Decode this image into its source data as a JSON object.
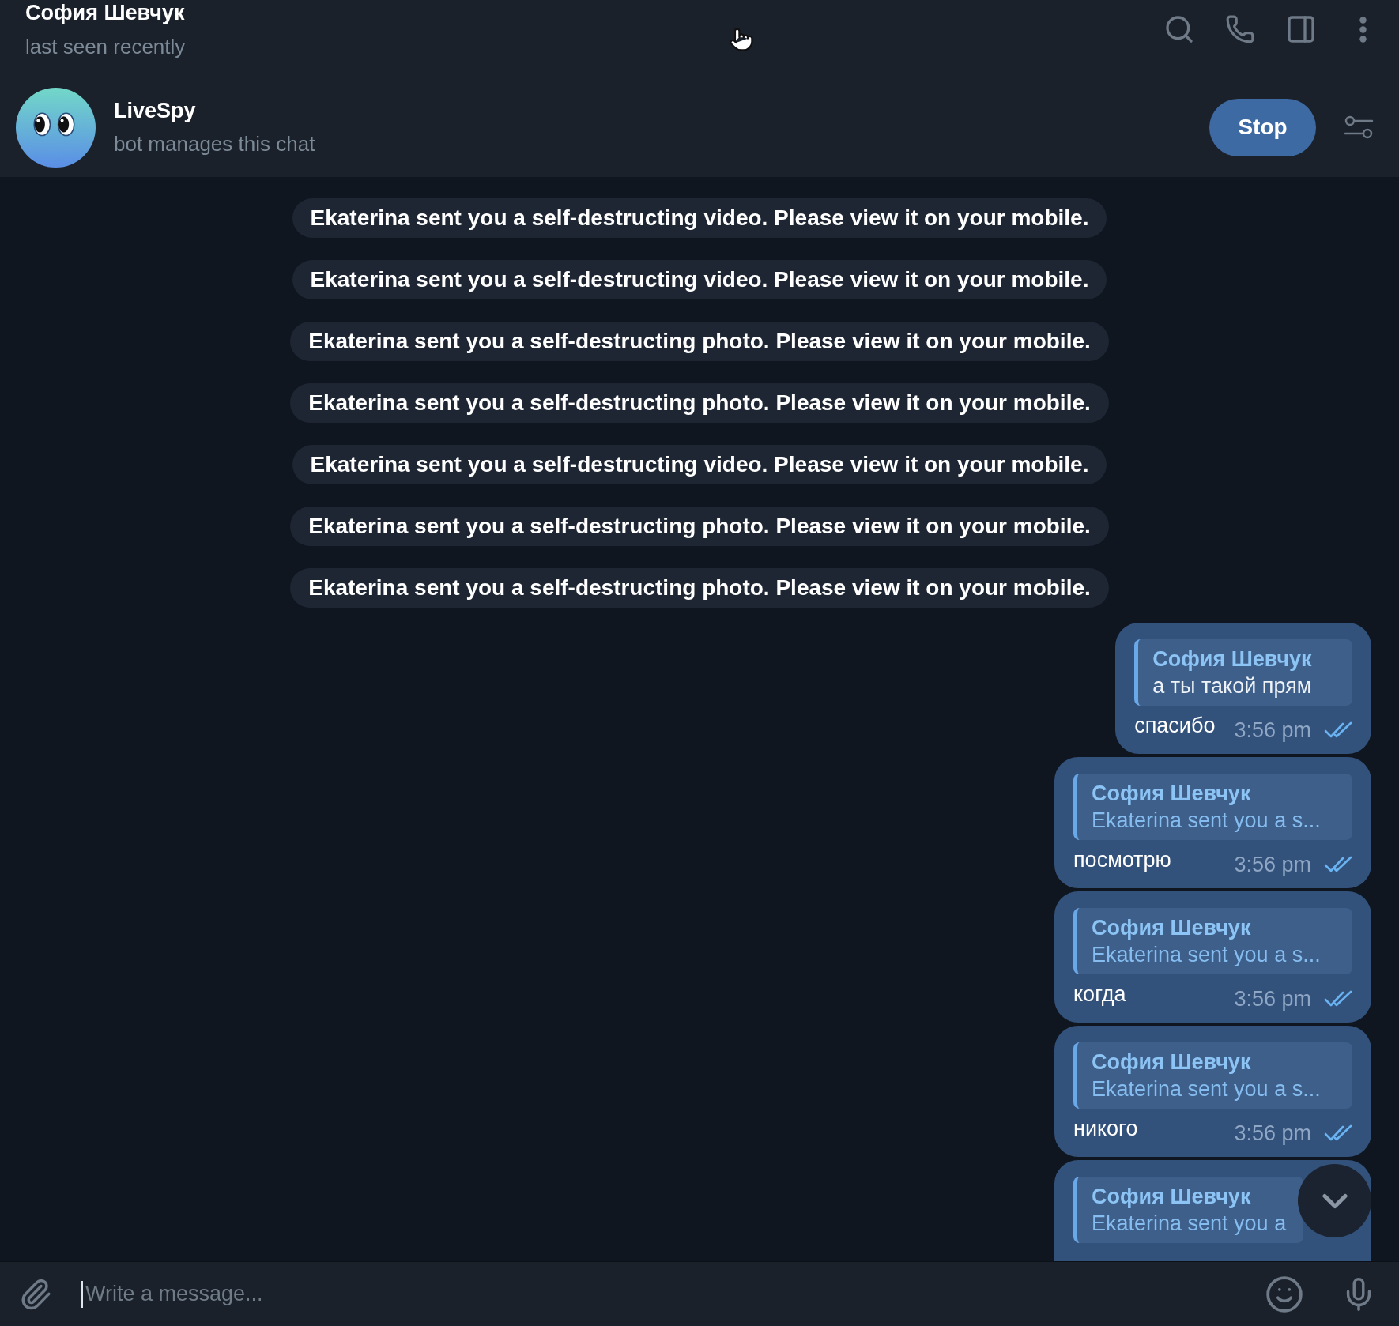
{
  "header": {
    "title": "София Шевчук",
    "status": "last seen recently"
  },
  "bot_bar": {
    "name": "LiveSpy",
    "subtitle": "bot manages this chat",
    "button": "Stop"
  },
  "service_messages": [
    "Ekaterina sent you a self-destructing video. Please view it on your mobile.",
    "Ekaterina sent you a self-destructing video. Please view it on your mobile.",
    "Ekaterina sent you a self-destructing photo. Please view it on your mobile.",
    "Ekaterina sent you a self-destructing photo. Please view it on your mobile.",
    "Ekaterina sent you a self-destructing video. Please view it on your mobile.",
    "Ekaterina sent you a self-destructing photo. Please view it on your mobile.",
    "Ekaterina sent you a self-destructing photo. Please view it on your mobile."
  ],
  "messages": [
    {
      "reply": {
        "name": "София Шевчук",
        "text": "а ты такой прям",
        "kind": "text"
      },
      "text": "спасибо",
      "time": "3:56 pm",
      "read": true
    },
    {
      "reply": {
        "name": "София Шевчук",
        "text": "Ekaterina sent you a s...",
        "kind": "service"
      },
      "text": "посмотрю",
      "time": "3:56 pm",
      "read": true
    },
    {
      "reply": {
        "name": "София Шевчук",
        "text": "Ekaterina sent you a s...",
        "kind": "service"
      },
      "text": "когда",
      "time": "3:56 pm",
      "read": true
    },
    {
      "reply": {
        "name": "София Шевчук",
        "text": "Ekaterina sent you a s...",
        "kind": "service"
      },
      "text": "никого",
      "time": "3:56 pm",
      "read": true
    },
    {
      "reply": {
        "name": "София Шевчук",
        "text": "Ekaterina sent you a",
        "kind": "service"
      }
    }
  ],
  "compose": {
    "placeholder": "Write a message..."
  }
}
